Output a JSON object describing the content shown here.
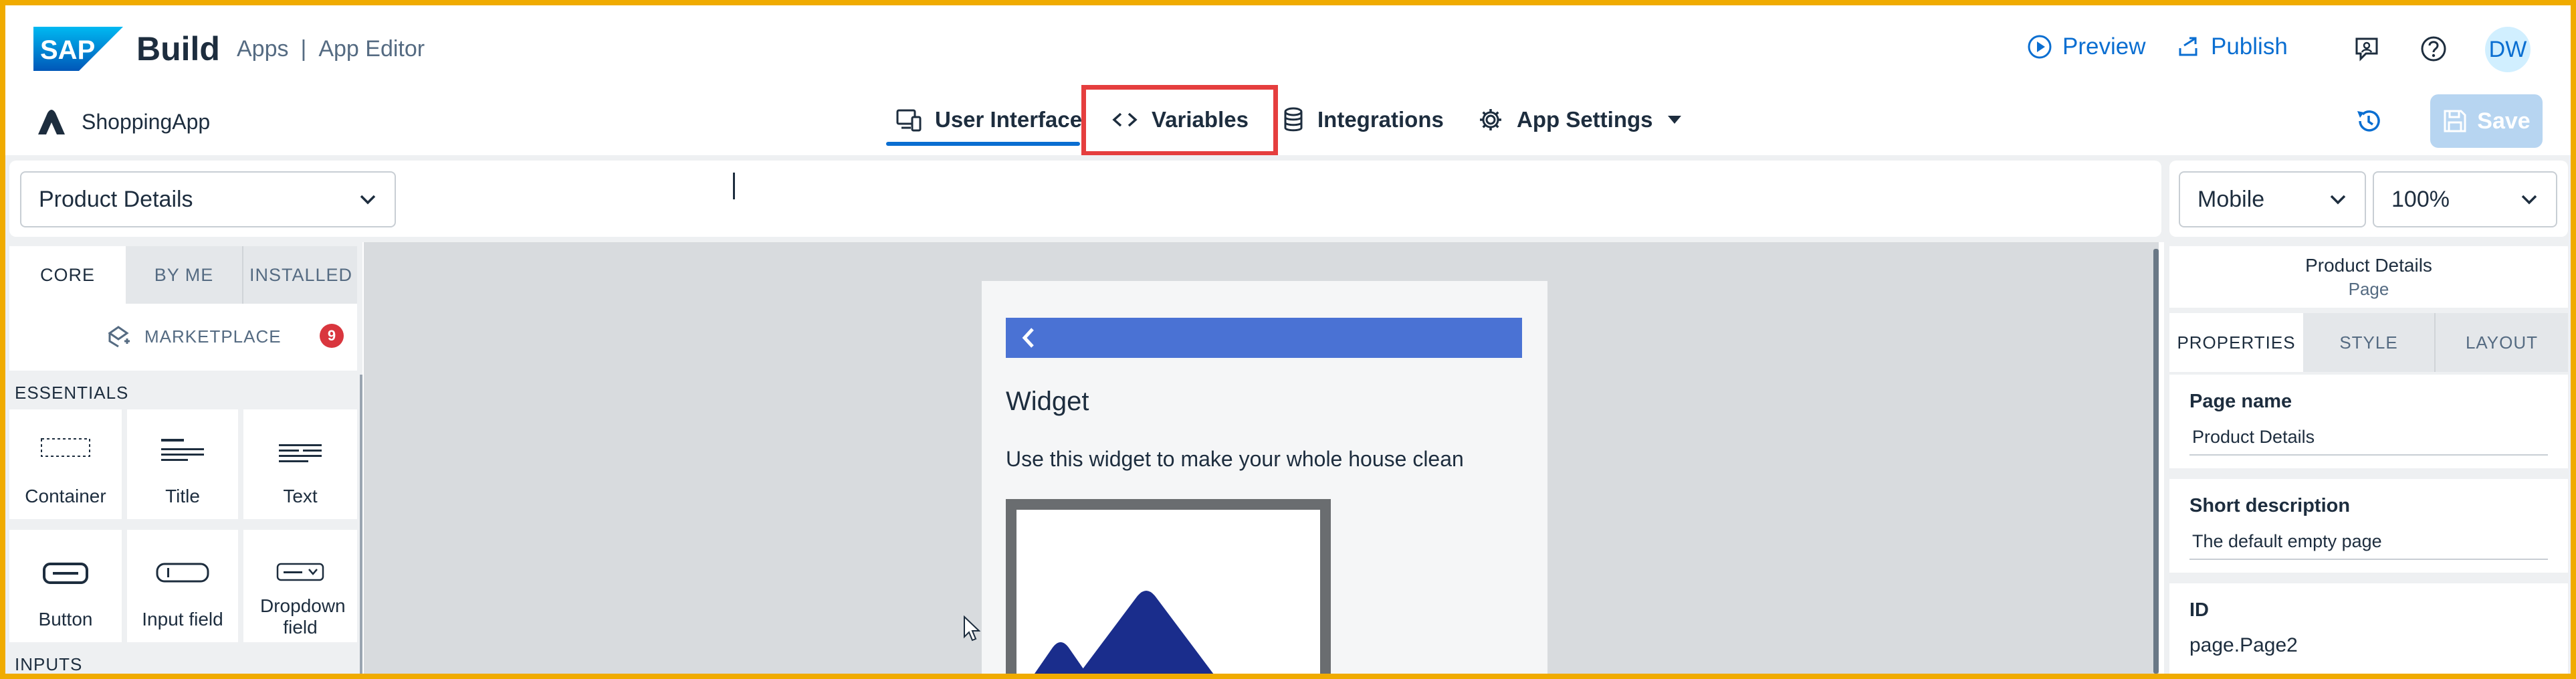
{
  "shell": {
    "logo_text": "SAP",
    "brand": "Build",
    "breadcrumb_apps": "Apps",
    "breadcrumb_sep": "|",
    "breadcrumb_editor": "App Editor",
    "preview_label": "Preview",
    "publish_label": "Publish",
    "avatar_initials": "DW"
  },
  "nav": {
    "app_name": "ShoppingApp",
    "tabs": [
      {
        "label": "User Interface"
      },
      {
        "label": "Variables"
      },
      {
        "label": "Integrations"
      },
      {
        "label": "App Settings"
      }
    ],
    "save_label": "Save"
  },
  "toolbar": {
    "page_select": "Product Details",
    "device_select": "Mobile",
    "zoom_select": "100%"
  },
  "left_panel": {
    "tabs": [
      "CORE",
      "BY ME",
      "INSTALLED"
    ],
    "marketplace_label": "MARKETPLACE",
    "marketplace_count": "9",
    "essentials_heading": "ESSENTIALS",
    "components": [
      "Container",
      "Title",
      "Text",
      "Button",
      "Input field",
      "Dropdown field"
    ],
    "inputs_heading": "INPUTS"
  },
  "canvas": {
    "widget_title": "Widget",
    "widget_text": "Use this widget to make your whole house clean"
  },
  "right_panel": {
    "page_title": "Product Details",
    "page_type": "Page",
    "tabs": [
      "PROPERTIES",
      "STYLE",
      "LAYOUT"
    ],
    "fields": [
      {
        "label": "Page name",
        "value": "Product Details"
      },
      {
        "label": "Short description",
        "value": "The default empty page"
      },
      {
        "label": "ID",
        "value": "page.Page2"
      }
    ]
  },
  "colors": {
    "accent": "#0a6ed1",
    "highlight_box": "#e53e3e",
    "screenshot_border": "#f0ab00",
    "canvas_header": "#4a72d4",
    "badge": "#d9363e"
  }
}
